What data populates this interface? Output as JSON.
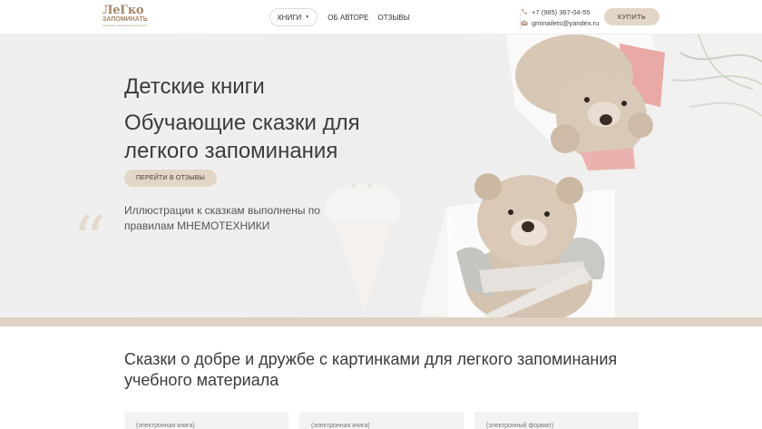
{
  "header": {
    "logo": {
      "main": "ЛеГко",
      "sub": "ЗАПОМИНАТЬ",
      "tagline": "серия книг запоминалок для детей"
    },
    "nav": {
      "books_label": "КНИГИ",
      "about_label": "ОБ АВТОРЕ",
      "reviews_label": "ОТЗЫВЫ"
    },
    "contacts": {
      "phone": "+7 (985) 367-04-55",
      "email": "gminailets@yandex.ru"
    },
    "buy_label": "КУПИТЬ"
  },
  "hero": {
    "title": "Детские книги",
    "subtitle": "Обучающие сказки для легкого запоминания",
    "button_label": "ПЕРЕЙТИ В ОТЗЫВЫ",
    "description": "Иллюстрации к сказкам выполнены по правилам МНЕМОТЕХНИКИ",
    "quote_mark": "“"
  },
  "section": {
    "title": "Сказки о добре и дружбе с картинками для легкого запоминания учебного материала",
    "cards": [
      {
        "label": "(электронная книга)"
      },
      {
        "label": "(электронная книга)"
      },
      {
        "label": "(электронный формат)"
      }
    ]
  },
  "colors": {
    "accent": "#e3d6c7",
    "hero_bg": "#f0efef",
    "stripe": "#dfd2c3",
    "logo": "#a8876a"
  }
}
